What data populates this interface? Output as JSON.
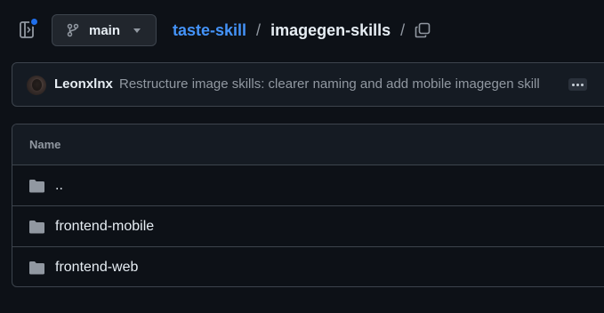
{
  "header": {
    "branch_label": "main",
    "breadcrumb": {
      "repo": "taste-skill",
      "separator": "/",
      "folder": "imagegen-skills"
    },
    "icons": {
      "sidebar_toggle": "sidebar-expand-icon",
      "branch": "git-branch-icon",
      "caret": "chevron-down-icon",
      "copy": "copy-icon"
    },
    "notification_color": "#1f6feb"
  },
  "commit": {
    "author": "Leonxlnx",
    "message": "Restructure image skills: clearer naming and add mobile imagegen skill",
    "more_icon": "ellipsis-icon"
  },
  "files": {
    "column_header": "Name",
    "rows": [
      {
        "name": "..",
        "icon": "folder-icon"
      },
      {
        "name": "frontend-mobile",
        "icon": "folder-icon"
      },
      {
        "name": "frontend-web",
        "icon": "folder-icon"
      }
    ]
  },
  "colors": {
    "background": "#0d1117",
    "link": "#4493f8",
    "border": "#3d444d",
    "muted_text": "#9198a1",
    "folder": "#9198a1"
  }
}
